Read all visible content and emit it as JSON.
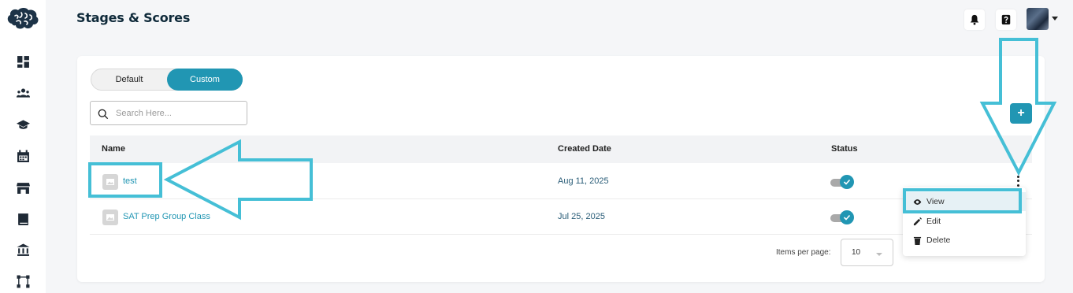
{
  "page": {
    "title": "Stages & Scores"
  },
  "sidebar": {
    "items": [
      {
        "icon": "dashboard-icon"
      },
      {
        "icon": "users-icon"
      },
      {
        "icon": "graduation-cap-icon"
      },
      {
        "icon": "calendar-icon"
      },
      {
        "icon": "store-icon"
      },
      {
        "icon": "book-icon"
      },
      {
        "icon": "bank-icon"
      },
      {
        "icon": "workflow-icon"
      }
    ]
  },
  "topbar": {
    "icons": [
      "bell-icon",
      "help-icon"
    ]
  },
  "toggle": {
    "default_label": "Default",
    "custom_label": "Custom",
    "selected": "Custom"
  },
  "search": {
    "placeholder": "Search Here...",
    "value": ""
  },
  "add_button": {
    "label": "+"
  },
  "table": {
    "columns": {
      "name": "Name",
      "created": "Created Date",
      "status": "Status"
    },
    "rows": [
      {
        "name": "test",
        "created": "Aug 11, 2025",
        "status_on": true
      },
      {
        "name": "SAT Prep Group Class",
        "created": "Jul 25, 2025",
        "status_on": true
      }
    ]
  },
  "pagination": {
    "items_per_page_label": "Items per page:",
    "items_per_page": "10"
  },
  "action_menu": {
    "view": "View",
    "edit": "Edit",
    "delete": "Delete",
    "highlighted": "View"
  },
  "colors": {
    "accent": "#2196b3",
    "annotation": "#45bfd6",
    "title": "#0f2a3a"
  }
}
